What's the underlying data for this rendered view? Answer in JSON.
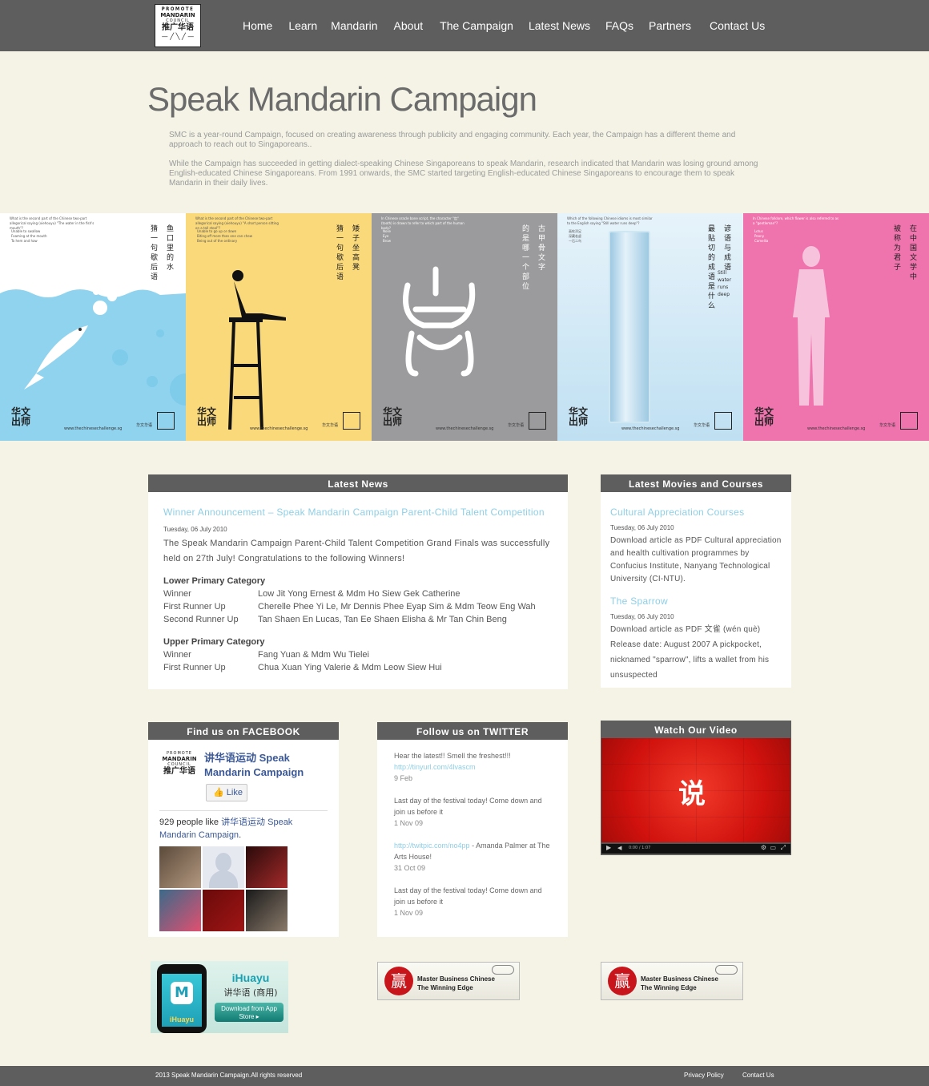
{
  "header": {
    "logo": {
      "line1": "PROMOTE",
      "line2": "MANDARIN",
      "line3": "COUNCIL",
      "line4": "推广华语",
      "line5": "理 事 会"
    },
    "nav": [
      "Home",
      "Learn",
      "Mandarin",
      "About",
      "The Campaign",
      "Latest News",
      "FAQs",
      "Partners",
      "Contact Us"
    ]
  },
  "intro": {
    "title": "Speak Mandarin Campaign",
    "paragraphs": [
      "SMC is a year-round Campaign, focused on creating awareness through publicity and engaging community.  Each year, the Campaign has a different theme and approach to reach out to Singaporeans..",
      "While the Campaign has succeeded in getting dialect-speaking Chinese Singaporeans to speak Mandarin, research indicated that Mandarin was losing ground among English-educated Chinese Singaporeans. From 1991 onwards, the SMC started targeting English-educated Chinese Singaporeans to encourage them to speak Mandarin in their daily lives."
    ]
  },
  "posters": [
    {
      "bg": "#ffffff",
      "q": "What is the second part of the Chinese two-part allegorical saying (xiehouyu) \"The water in the fish's mouth\"?",
      "opts": [
        "Unable to swallow",
        "Foaming at the mouth",
        "To hem and haw"
      ],
      "v1": "鱼口里的水",
      "v2": "猜一句歇后语",
      "brand": "华文\n出师",
      "url": "www.thechinesechallenge.sg",
      "org": "华文华语"
    },
    {
      "bg": "#fad97a",
      "q": "What is the second part of the Chinese two-part allegorical saying (xiehouyu) \"A short person sitting on a tall stool\"?",
      "opts": [
        "Unable to go up or down",
        "Biting off more than one can chew",
        "Being out of the ordinary"
      ],
      "v1": "矮子坐高凳",
      "v2": "猜一句歇后语",
      "brand": "华文\n出师",
      "url": "www.thechinesechallenge.sg",
      "org": "华文华语"
    },
    {
      "bg": "#9b9b9d",
      "q": "In Chinese oracle bone script, the character \"齿\" (tooth) is drawn to refer to which part of the human body?",
      "opts": [
        "Nose",
        "Eye",
        "Brow"
      ],
      "v1": "古甲骨文字",
      "v2": "的是哪一个部位",
      "brand": "华文\n出师",
      "url": "www.thechinesechallenge.sg",
      "org": "华文华语"
    },
    {
      "bg": "#c9e6f5",
      "q": "Which of the following Chinese idioms is most similar to the English saying \"Still water runs deep\"?",
      "opts": [
        "画蛇添足",
        "深藏若虚",
        "一石二鸟"
      ],
      "v1": "谚语与成语",
      "v2": "最贴切的成语是什么",
      "still": "Still water runs deep",
      "brand": "华文\n出师",
      "url": "www.thechinesechallenge.sg",
      "org": "华文华语"
    },
    {
      "bg": "#ef73ad",
      "q": "In Chinese folklore, which flower is also referred to as a \"gentleman\"?",
      "opts": [
        "Lotus",
        "Peony",
        "Camellia"
      ],
      "v1": "在中国文学中",
      "v2": "被称为君子",
      "brand": "华文\n出师",
      "url": "www.thechinesechallenge.sg",
      "org": "华文华语"
    }
  ],
  "news": {
    "heading": "Latest News",
    "link": "Winner Announcement – Speak Mandarin Campaign Parent-Child Talent Competition",
    "date": "Tuesday, 06 July 2010",
    "text": "The Speak Mandarin Campaign Parent-Child Talent Competition Grand Finals was successfully held on 27th July! Congratulations to the following Winners!",
    "categories": [
      {
        "name": "Lower Primary Category",
        "rows": [
          {
            "k": "Winner",
            "v": "Low Jit Yong Ernest & Mdm Ho Siew Gek Catherine"
          },
          {
            "k": "First Runner Up",
            "v": "Cherelle Phee Yi Le, Mr Dennis Phee Eyap Sim & Mdm Teow Eng Wah"
          },
          {
            "k": "Second Runner Up",
            "v": "Tan Shaen En Lucas, Tan Ee Shaen Elisha & Mr Tan Chin Beng"
          }
        ]
      },
      {
        "name": "Upper Primary Category",
        "rows": [
          {
            "k": "Winner",
            "v": "Fang Yuan & Mdm Wu Tielei"
          },
          {
            "k": "First Runner Up",
            "v": "Chua Xuan Ying Valerie & Mdm Leow Siew Hui"
          }
        ]
      }
    ]
  },
  "movies": {
    "heading": "Latest Movies and Courses",
    "items": [
      {
        "link": "Cultural Appreciation Courses",
        "date": "Tuesday, 06 July 2010",
        "text": "Download article as PDF Cultural appreciation and health cultivation programmes by Confucius Institute, Nanyang Technological University (CI-NTU)."
      },
      {
        "link": "The Sparrow",
        "date": "Tuesday, 06 July 2010",
        "text": "Download article as PDF 文雀 (wén què) Release date: August 2007 A pickpocket, nicknamed \"sparrow\", lifts a wallet from his unsuspected"
      }
    ]
  },
  "facebook": {
    "heading": "Find us on FACEBOOK",
    "page_name": "讲华语运动 Speak Mandarin Campaign",
    "like": "Like",
    "count_text": "929 people like ",
    "count_link": "讲华语运动 Speak Mandarin Campaign",
    "count_end": "."
  },
  "twitter": {
    "heading": "Follow us on TWITTER",
    "items": [
      {
        "text": "Hear the latest!! Smell the freshest!!!",
        "link": "http://tinyurl.com/4lvascm",
        "after": "",
        "date": "9 Feb"
      },
      {
        "text": "Last day of the festival today! Come down and join us before it",
        "link": "",
        "after": "",
        "date": "1 Nov 09"
      },
      {
        "text": "",
        "link": "http://twitpic.com/no4pp",
        "after": " - Amanda Palmer at The Arts House!",
        "date": "31 Oct 09"
      },
      {
        "text": "Last day of the festival today! Come down and join us before it",
        "link": "",
        "after": "",
        "date": "1 Nov 09"
      }
    ]
  },
  "video": {
    "heading": "Watch Our Video",
    "char": "说",
    "time": "0:00 / 1:07"
  },
  "banners": {
    "ihuayu": {
      "title": "iHuayu",
      "sub": "讲华语 (商用)",
      "btn": "Download from App Store ▸",
      "app": "iHuayu"
    },
    "business": {
      "char": "赢",
      "line1": "Master Business Chinese",
      "line2": "The Winning Edge"
    }
  },
  "footer": {
    "copyright": "2013 Speak Mandarin Campaign.All rights reserved",
    "privacy": "Privacy Policy",
    "contact": "Contact Us"
  }
}
